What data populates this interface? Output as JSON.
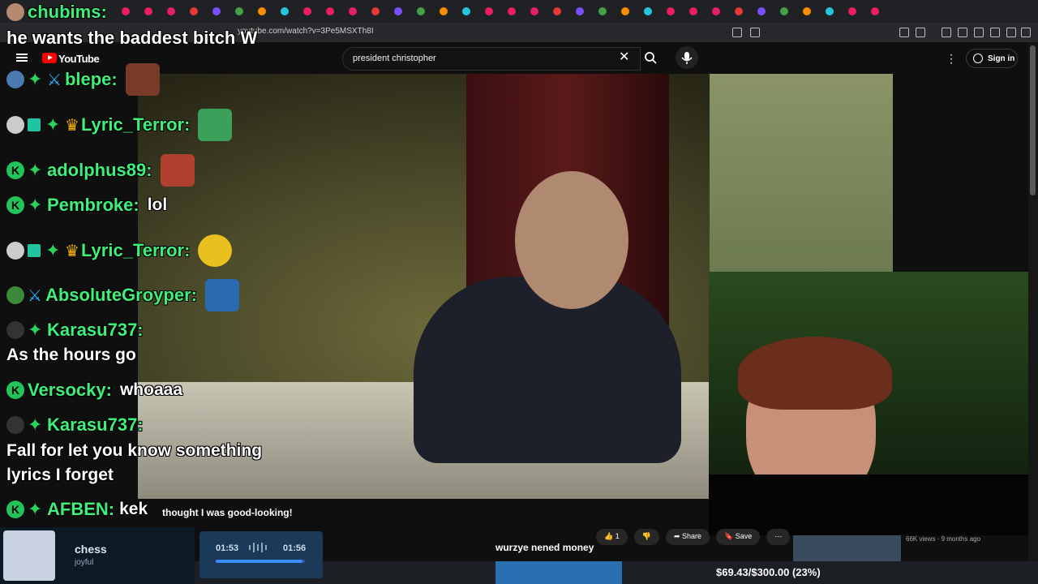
{
  "browser": {
    "url": "youtube.com/watch?v=3Pe5MSXTh8I"
  },
  "youtube": {
    "logo": "YouTube",
    "search_value": "president christopher",
    "signin_label": "Sign in",
    "icons": [
      "menu-icon",
      "close-icon",
      "search-icon",
      "mic-icon",
      "more-vert-icon",
      "user-icon"
    ]
  },
  "overlay": {
    "top_user": "chubims:",
    "top_message": "he wants the baddest bitch W"
  },
  "chat": [
    {
      "user": "blepe:",
      "text": ""
    },
    {
      "user": "Lyric_Terror:",
      "text": ""
    },
    {
      "user": "adolphus89:",
      "text": ""
    },
    {
      "user": "Pembroke:",
      "text": "lol"
    },
    {
      "user": "Lyric_Terror:",
      "text": ""
    },
    {
      "user": "AbsoluteGroyper:",
      "text": ""
    },
    {
      "user": "Karasu737:",
      "text": "As the hours go"
    },
    {
      "user": "Versocky:",
      "text": "whoaaa"
    },
    {
      "user": "Karasu737:",
      "text": "Fall for let you know something",
      "text2": "lyrics I forget"
    },
    {
      "user": "AFBEN:",
      "text": "kek"
    }
  ],
  "video_meta": {
    "caption": "thought I was good-looking!",
    "like_count": "1",
    "share_label": "Share",
    "save_label": "Save",
    "views": "66K views · 9 months ago"
  },
  "music": {
    "title": "chess",
    "subtitle": "joyful",
    "elapsed": "01:53",
    "total": "01:56",
    "progress": 0.97
  },
  "ticker": "wurzye nened money",
  "goal": {
    "text": "$69.43/$300.00 (23%)",
    "fraction": 0.23
  },
  "colors": {
    "username": "#3ef07a",
    "yt_red": "#ff0000",
    "k_badge": "#21c45a"
  }
}
